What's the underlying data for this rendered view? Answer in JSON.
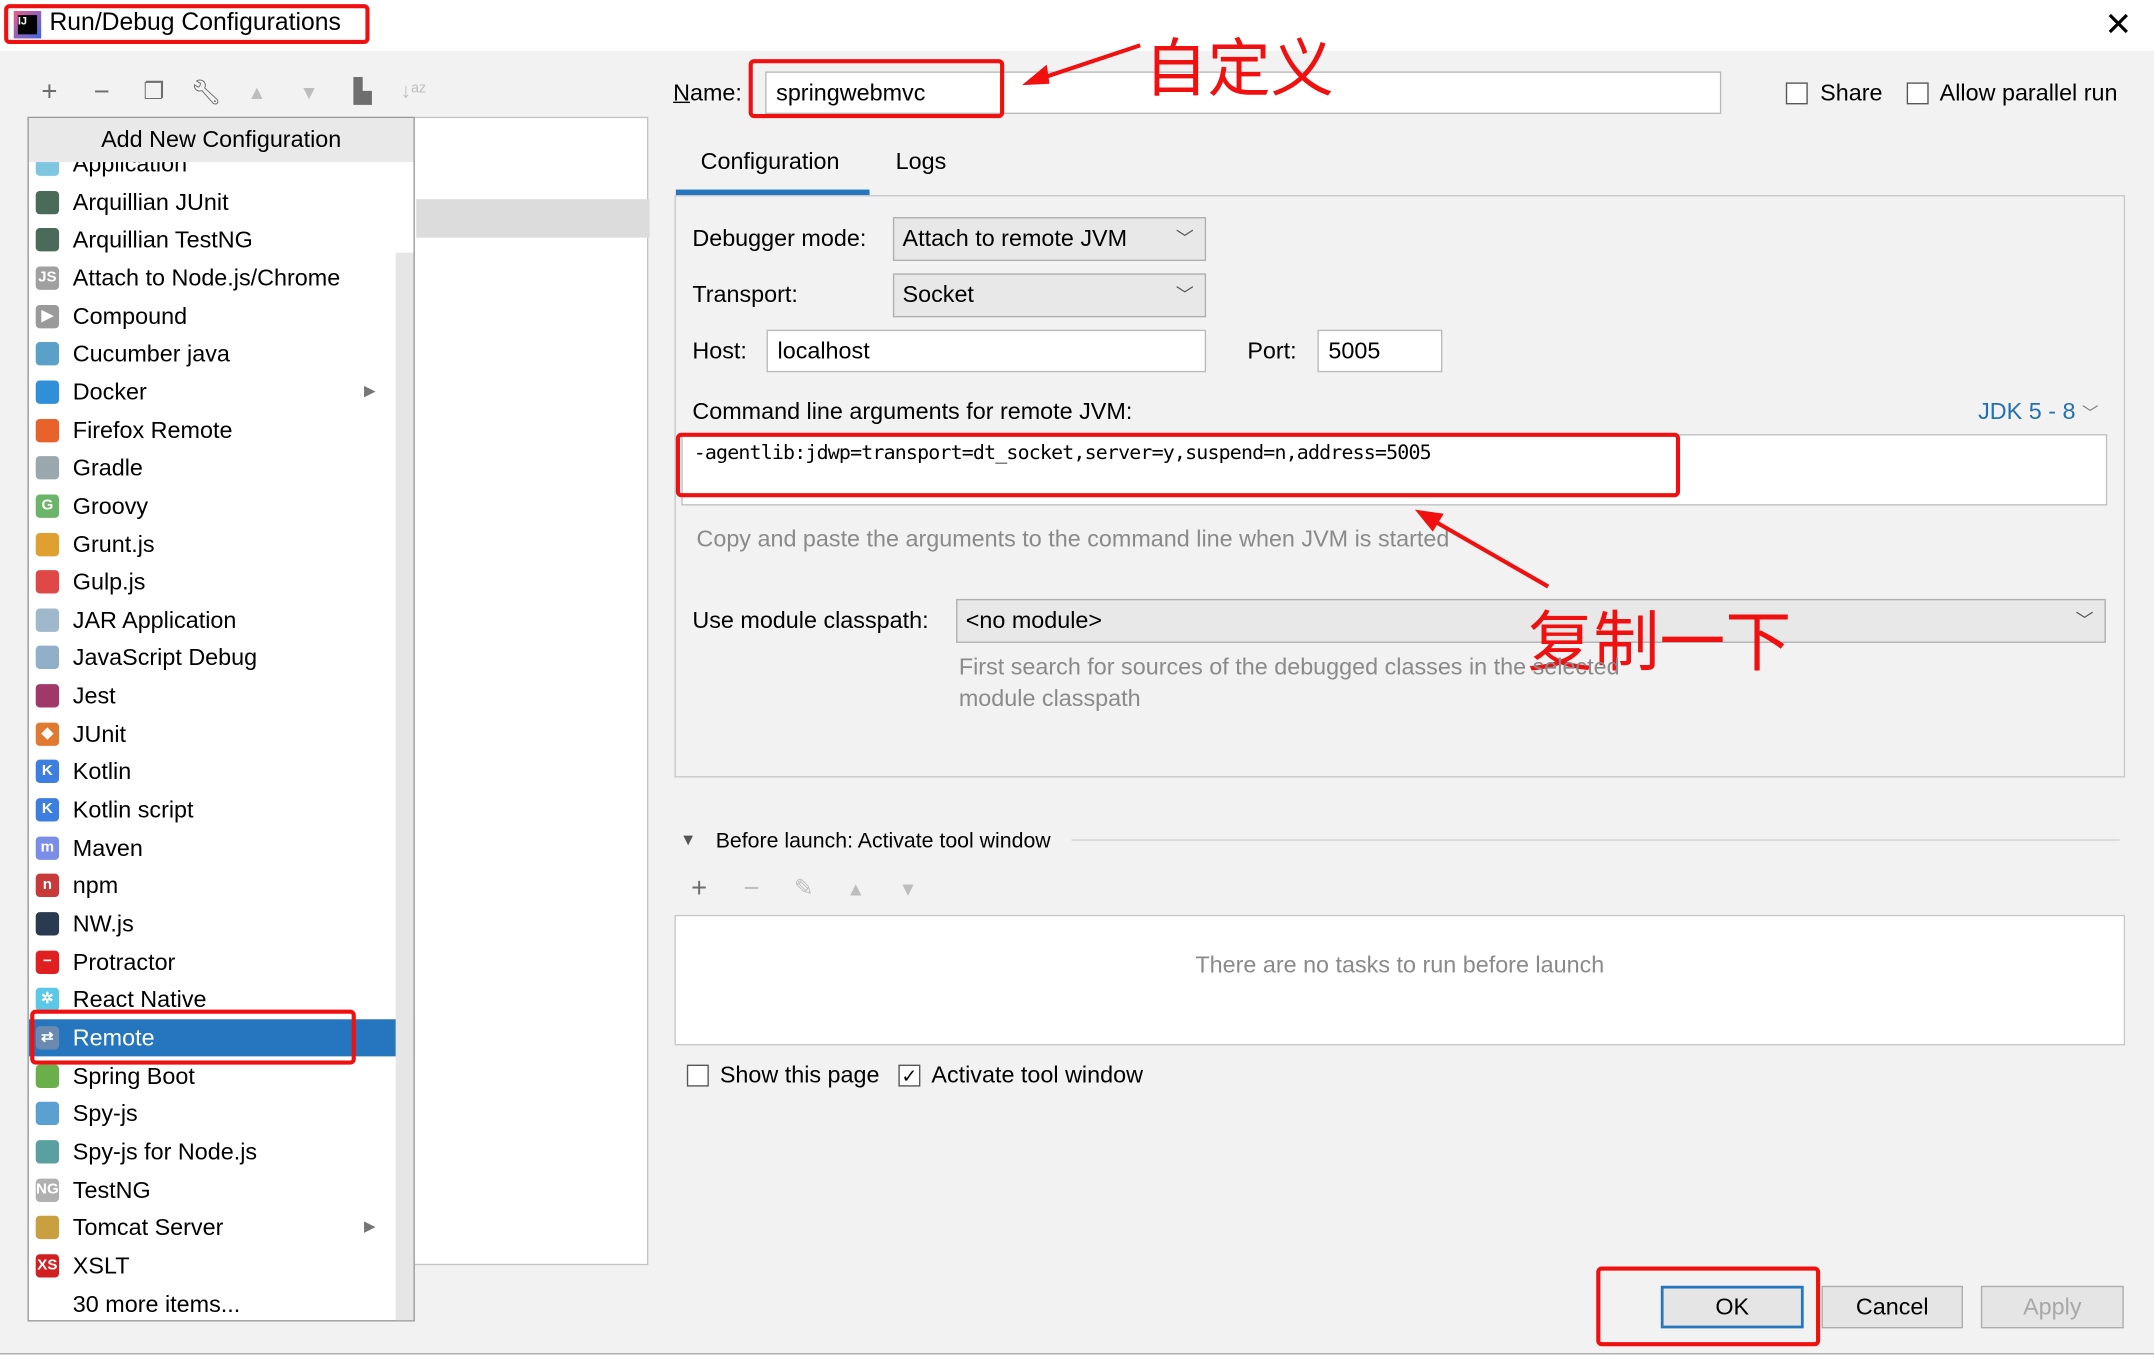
{
  "window": {
    "title": "Run/Debug Configurations",
    "close_icon": "close-icon"
  },
  "toolbar": {
    "icons": [
      "plus-icon",
      "minus-icon",
      "copy-icon",
      "wrench-icon",
      "arrow-up-icon",
      "arrow-down-icon",
      "folder-add-icon",
      "sort-alpha-icon"
    ]
  },
  "popup": {
    "header": "Add New Configuration",
    "items": [
      {
        "label": "Application",
        "icon": "application-icon",
        "color": "#7fc6e0",
        "glyph": ""
      },
      {
        "label": "Arquillian JUnit",
        "icon": "arquillian-icon",
        "color": "#4a6a5a",
        "glyph": ""
      },
      {
        "label": "Arquillian TestNG",
        "icon": "arquillian-icon",
        "color": "#4a6a5a",
        "glyph": ""
      },
      {
        "label": "Attach to Node.js/Chrome",
        "icon": "nodejs-attach-icon",
        "color": "#a0a0a0",
        "glyph": "JS"
      },
      {
        "label": "Compound",
        "icon": "compound-icon",
        "color": "#9a9a9a",
        "glyph": "▶"
      },
      {
        "label": "Cucumber java",
        "icon": "cucumber-icon",
        "color": "#5aa0c8",
        "glyph": ""
      },
      {
        "label": "Docker",
        "icon": "docker-icon",
        "color": "#2f8fd8",
        "glyph": "",
        "submenu": true
      },
      {
        "label": "Firefox Remote",
        "icon": "firefox-icon",
        "color": "#e8632a",
        "glyph": ""
      },
      {
        "label": "Gradle",
        "icon": "gradle-icon",
        "color": "#9aa7ad",
        "glyph": ""
      },
      {
        "label": "Groovy",
        "icon": "groovy-icon",
        "color": "#6bb56b",
        "glyph": "G"
      },
      {
        "label": "Grunt.js",
        "icon": "grunt-icon",
        "color": "#e0a030",
        "glyph": ""
      },
      {
        "label": "Gulp.js",
        "icon": "gulp-icon",
        "color": "#e04848",
        "glyph": ""
      },
      {
        "label": "JAR Application",
        "icon": "jar-icon",
        "color": "#9fb8cc",
        "glyph": ""
      },
      {
        "label": "JavaScript Debug",
        "icon": "js-debug-icon",
        "color": "#8fb0c8",
        "glyph": ""
      },
      {
        "label": "Jest",
        "icon": "jest-icon",
        "color": "#a0386a",
        "glyph": ""
      },
      {
        "label": "JUnit",
        "icon": "junit-icon",
        "color": "#e07a30",
        "glyph": "◆"
      },
      {
        "label": "Kotlin",
        "icon": "kotlin-icon",
        "color": "#3d7fe0",
        "glyph": "K"
      },
      {
        "label": "Kotlin script",
        "icon": "kotlin-icon",
        "color": "#3d7fe0",
        "glyph": "K"
      },
      {
        "label": "Maven",
        "icon": "maven-icon",
        "color": "#7a8ee8",
        "glyph": "m"
      },
      {
        "label": "npm",
        "icon": "npm-icon",
        "color": "#c83a3a",
        "glyph": "n"
      },
      {
        "label": "NW.js",
        "icon": "nwjs-icon",
        "color": "#2a3a50",
        "glyph": ""
      },
      {
        "label": "Protractor",
        "icon": "protractor-icon",
        "color": "#e02020",
        "glyph": "−"
      },
      {
        "label": "React Native",
        "icon": "react-icon",
        "color": "#5ac8e8",
        "glyph": "✲"
      },
      {
        "label": "Remote",
        "icon": "remote-icon",
        "color": "#6a8ab0",
        "glyph": "⇄",
        "selected": true
      },
      {
        "label": "Spring Boot",
        "icon": "spring-boot-icon",
        "color": "#6ab04a",
        "glyph": ""
      },
      {
        "label": "Spy-js",
        "icon": "spyjs-icon",
        "color": "#5aa0d0",
        "glyph": ""
      },
      {
        "label": "Spy-js for Node.js",
        "icon": "spyjs-icon",
        "color": "#5aa0a0",
        "glyph": ""
      },
      {
        "label": "TestNG",
        "icon": "testng-icon",
        "color": "#b0b0b0",
        "glyph": "NG"
      },
      {
        "label": "Tomcat Server",
        "icon": "tomcat-icon",
        "color": "#c8a040",
        "glyph": "",
        "submenu": true
      },
      {
        "label": "XSLT",
        "icon": "xslt-icon",
        "color": "#d02020",
        "glyph": "XS"
      },
      {
        "label": "30 more items...",
        "icon": "",
        "color": "",
        "glyph": ""
      }
    ]
  },
  "form": {
    "name_label": "Name:",
    "name_value": "springwebmvc",
    "share_label": "Share",
    "share_checked": false,
    "parallel_label": "Allow parallel run",
    "parallel_checked": false,
    "tabs": [
      {
        "label": "Configuration",
        "active": true
      },
      {
        "label": "Logs",
        "active": false
      }
    ],
    "debugger_mode_label": "Debugger mode:",
    "debugger_mode_value": "Attach to remote JVM",
    "transport_label": "Transport:",
    "transport_value": "Socket",
    "host_label": "Host:",
    "host_value": "localhost",
    "port_label": "Port:",
    "port_value": "5005",
    "cmd_label": "Command line arguments for remote JVM:",
    "jdk_value": "JDK 5 - 8",
    "cmd_value": "-agentlib:jdwp=transport=dt_socket,server=y,suspend=n,address=5005",
    "cmd_hint": "Copy and paste the arguments to the command line when JVM is started",
    "module_label": "Use module classpath:",
    "module_value": "<no module>",
    "module_hint_1": "First search for sources of the debugged classes in the selected",
    "module_hint_2": "module classpath",
    "accent": "#2675bf"
  },
  "before_launch": {
    "title": "Before launch: Activate tool window",
    "empty_text": "There are no tasks to run before launch",
    "show_page_label": "Show this page",
    "show_page_checked": false,
    "activate_label": "Activate tool window",
    "activate_checked": true
  },
  "buttons": {
    "ok": "OK",
    "cancel": "Cancel",
    "apply": "Apply"
  },
  "annotations": {
    "name_note": "自定义",
    "copy_note": "复制一下",
    "color": "#f01010"
  }
}
